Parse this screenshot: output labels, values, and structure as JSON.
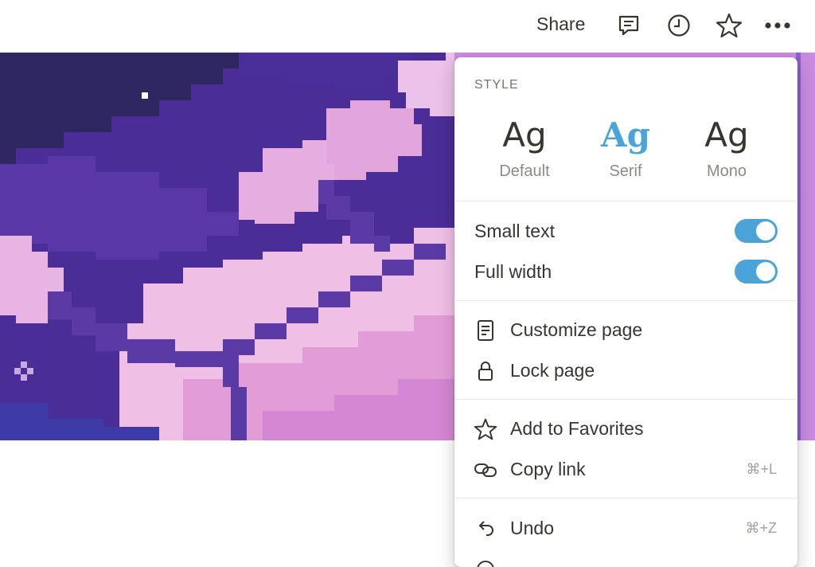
{
  "topbar": {
    "share_label": "Share",
    "icons": [
      "comment-icon",
      "history-icon",
      "star-icon",
      "more-icon"
    ]
  },
  "menu": {
    "style_heading": "STYLE",
    "styles": [
      {
        "sample": "Ag",
        "label": "Default",
        "selected": false
      },
      {
        "sample": "Ag",
        "label": "Serif",
        "selected": true
      },
      {
        "sample": "Ag",
        "label": "Mono",
        "selected": false
      }
    ],
    "toggles": [
      {
        "label": "Small text",
        "on": true
      },
      {
        "label": "Full width",
        "on": true
      }
    ],
    "items": [
      {
        "label": "Customize page",
        "icon": "document-icon"
      },
      {
        "label": "Lock page",
        "icon": "lock-icon"
      },
      {
        "label": "Add to Favorites",
        "icon": "star-icon"
      },
      {
        "label": "Copy link",
        "icon": "link-icon",
        "shortcut": "⌘+L"
      },
      {
        "label": "Undo",
        "icon": "undo-icon",
        "shortcut": "⌘+Z"
      }
    ]
  },
  "colors": {
    "accent": "#4aa3d9",
    "cover_dark": "#3a2a6e",
    "cover_mid": "#4b2d97",
    "cover_pink": "#e8b4e3"
  }
}
